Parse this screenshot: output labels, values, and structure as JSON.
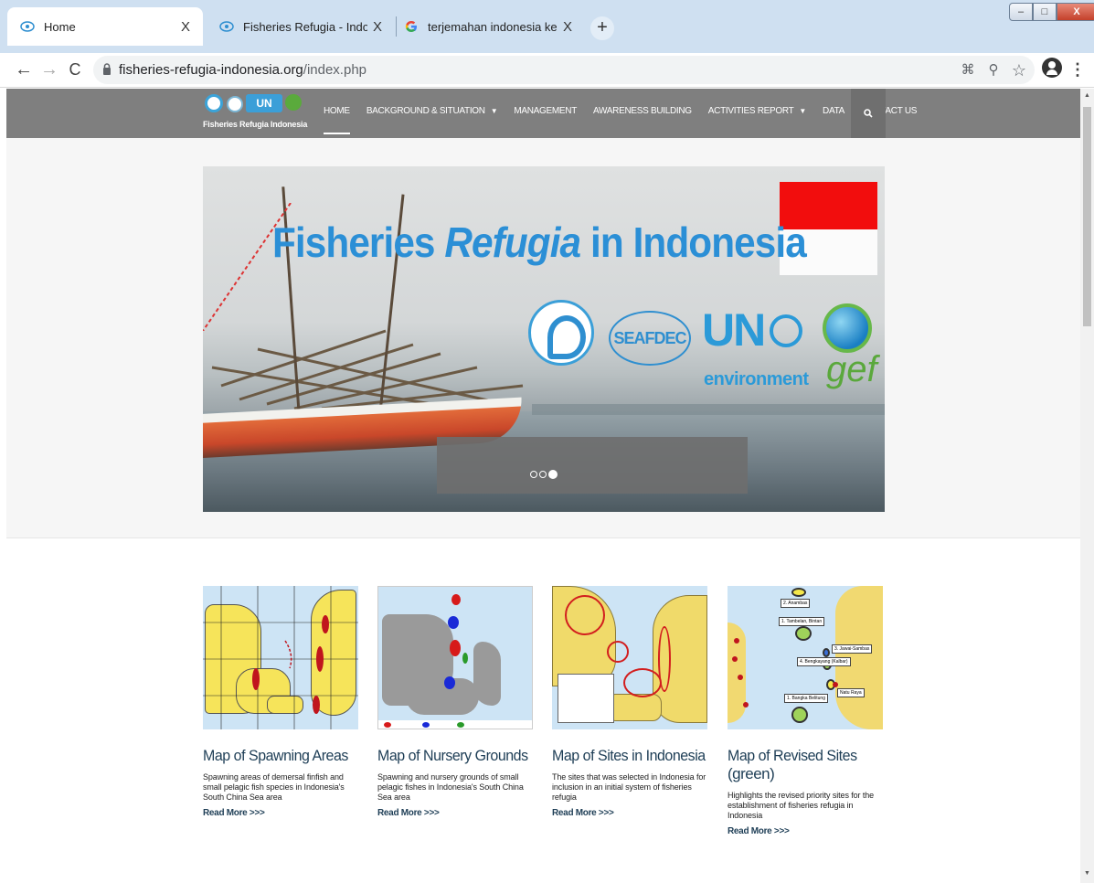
{
  "browser": {
    "tabs": [
      {
        "title": "Home",
        "close": "X"
      },
      {
        "title": "Fisheries Refugia - Indonesia",
        "close": "X"
      },
      {
        "title": "terjemahan indonesia ke inggris",
        "close": "X"
      }
    ],
    "new_tab": "+",
    "url_host": "fisheries-refugia-indonesia.org",
    "url_path": "/index.php",
    "window_controls": {
      "minimize": "–",
      "maximize": "□",
      "close": "X"
    }
  },
  "site": {
    "logo_caption": "Fisheries Refugia Indonesia",
    "logo_un": "UN",
    "nav": [
      {
        "label": "HOME",
        "active": true,
        "dropdown": false
      },
      {
        "label": "BACKGROUND & SITUATION",
        "active": false,
        "dropdown": true
      },
      {
        "label": "MANAGEMENT",
        "active": false,
        "dropdown": false
      },
      {
        "label": "AWARENESS BUILDING",
        "active": false,
        "dropdown": false
      },
      {
        "label": "ACTIVITIES REPORT",
        "active": false,
        "dropdown": true
      },
      {
        "label": "DATA",
        "active": false,
        "dropdown": false
      },
      {
        "label": "CONTACT US",
        "active": false,
        "dropdown": false
      }
    ],
    "search_icon": "search-icon"
  },
  "hero": {
    "title_part1": "Fisheries ",
    "title_part2": "Refugia",
    "title_part3": " in Indonesia",
    "seafdec": "SEAFDEC",
    "un": "UN",
    "environment": "environment",
    "gef": "gef",
    "slides_total": 3,
    "slide_active": 3
  },
  "cards": [
    {
      "title": "Map of Spawning Areas",
      "desc": "Spawning areas of demersal finfish and small pelagic fish species in Indonesia's South China Sea area",
      "more": "Read More >>>"
    },
    {
      "title": "Map of Nursery Grounds",
      "desc": "Spawning and nursery grounds of small pelagic fishes in Indonesia's South China Sea area",
      "more": "Read More >>>"
    },
    {
      "title": "Map of Sites in Indonesia",
      "desc": "The sites that was selected in Indonesia for inclusion in an initial system of fisheries refugia",
      "more": "Read More >>>"
    },
    {
      "title_line1": "Map of Revised Sites",
      "title_line2": "(green)",
      "desc": "Highlights the revised priority sites for the establishment of fisheries refugia in Indonesia",
      "more": "Read More >>>"
    }
  ],
  "map_labels": {
    "m4_a": "2. Anambas",
    "m4_b": "1. Tambelan, Bintan",
    "m4_c": "3. Jawai-Sambas",
    "m4_d": "4. Bengkayang (Kalbar)",
    "m4_e": "1. Bangka Belitung",
    "m4_f": "Natu Raya"
  },
  "colors": {
    "nav_bg": "#7f7f7f",
    "title_blue": "#2b8fd6",
    "card_title": "#1e3e56",
    "tab_bar": "#cfe0f1"
  }
}
